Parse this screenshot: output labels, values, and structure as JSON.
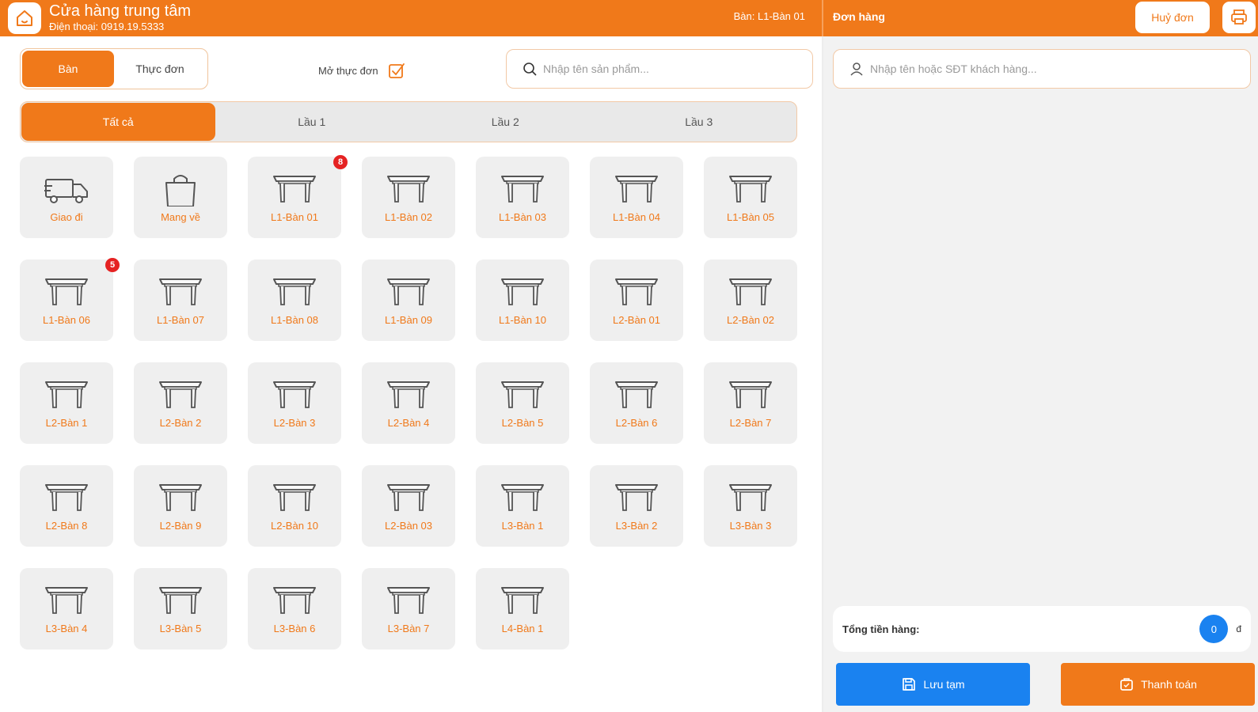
{
  "header": {
    "store_name": "Cửa hàng trung tâm",
    "phone": "Điện thoại: 0919.19.5333",
    "table_label": "Bàn: L1-Bàn 01",
    "order_title": "Đơn hàng",
    "cancel_label": "Huỷ đơn"
  },
  "mode_tabs": {
    "table": "Bàn",
    "menu": "Thực đơn"
  },
  "open_menu_label": "Mở thực đơn",
  "search": {
    "placeholder": "Nhập tên sản phẩm..."
  },
  "floor_tabs": {
    "all": "Tất cả",
    "f1": "Lầu 1",
    "f2": "Lầu 2",
    "f3": "Lầu 3"
  },
  "tiles": [
    {
      "label": "Giao đi"
    },
    {
      "label": "Mang về"
    },
    {
      "label": "L1-Bàn 01",
      "badge": "8"
    },
    {
      "label": "L1-Bàn 02"
    },
    {
      "label": "L1-Bàn 03"
    },
    {
      "label": "L1-Bàn 04"
    },
    {
      "label": "L1-Bàn 05"
    },
    {
      "label": "L1-Bàn 06",
      "badge": "5"
    },
    {
      "label": "L1-Bàn 07"
    },
    {
      "label": "L1-Bàn 08"
    },
    {
      "label": "L1-Bàn 09"
    },
    {
      "label": "L1-Bàn 10"
    },
    {
      "label": "L2-Bàn 01"
    },
    {
      "label": "L2-Bàn 02"
    },
    {
      "label": "L2-Bàn 1"
    },
    {
      "label": "L2-Bàn 2"
    },
    {
      "label": "L2-Bàn 3"
    },
    {
      "label": "L2-Bàn 4"
    },
    {
      "label": "L2-Bàn 5"
    },
    {
      "label": "L2-Bàn 6"
    },
    {
      "label": "L2-Bàn 7"
    },
    {
      "label": "L2-Bàn 8"
    },
    {
      "label": "L2-Bàn 9"
    },
    {
      "label": "L2-Bàn 10"
    },
    {
      "label": "L2-Bàn 03"
    },
    {
      "label": "L3-Bàn 1"
    },
    {
      "label": "L3-Bàn 2"
    },
    {
      "label": "L3-Bàn 3"
    },
    {
      "label": "L3-Bàn 4"
    },
    {
      "label": "L3-Bàn 5"
    },
    {
      "label": "L3-Bàn 6"
    },
    {
      "label": "L3-Bàn 7"
    },
    {
      "label": "L4-Bàn 1"
    }
  ],
  "order": {
    "customer_placeholder": "Nhập tên hoặc SĐT khách hàng...",
    "total_label": "Tổng tiền hàng:",
    "total_value": "0",
    "currency": "đ",
    "save_label": "Lưu tạm",
    "pay_label": "Thanh toán"
  },
  "colors": {
    "accent": "#f0791a",
    "primary_blue": "#1a82f0",
    "badge_red": "#e52222",
    "tile_bg": "#efefef"
  }
}
